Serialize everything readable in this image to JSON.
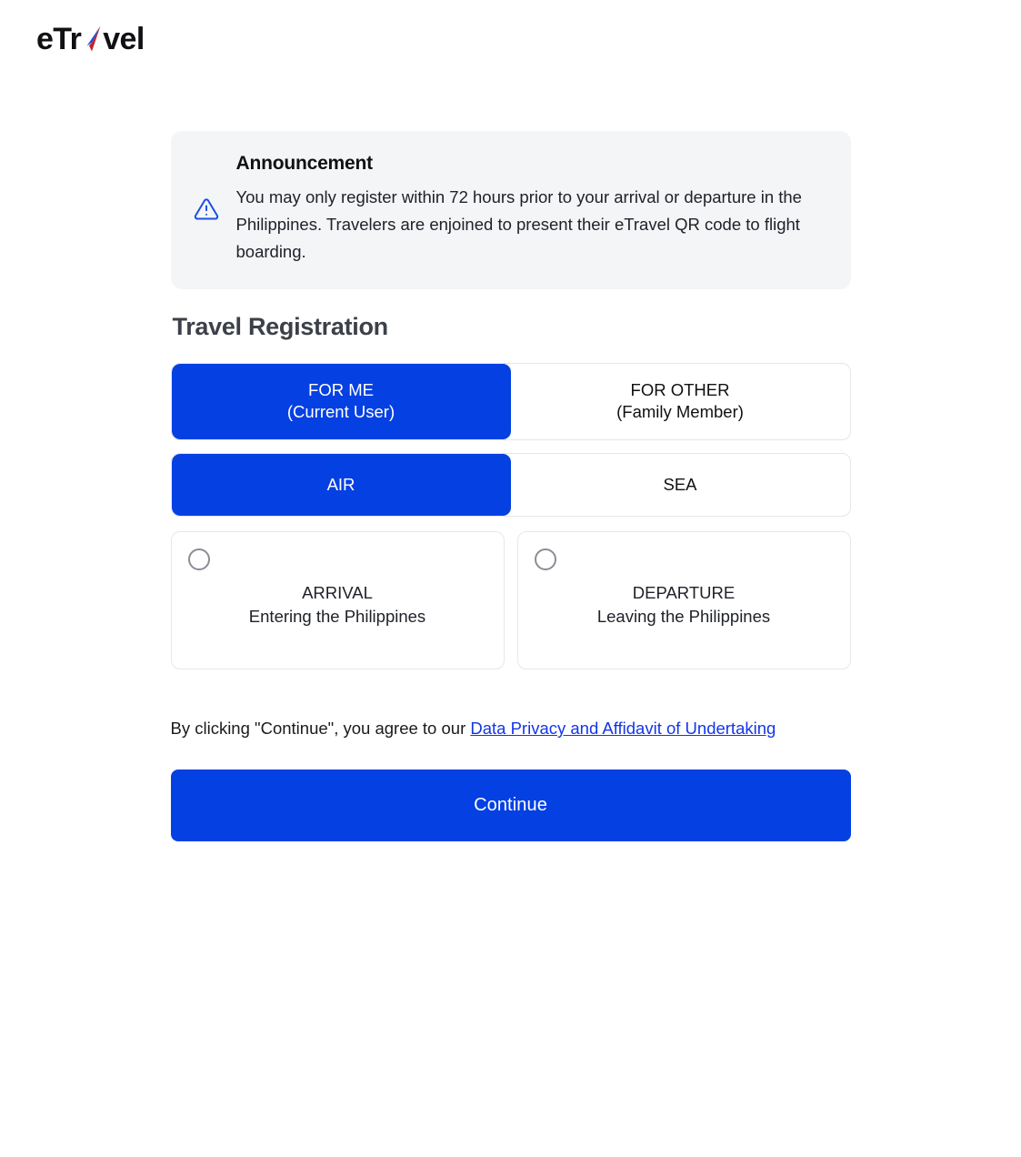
{
  "brand": {
    "name_prefix": "eTr",
    "name_suffix": "vel",
    "mark_icon": "paper-plane-icon",
    "colors": {
      "blue": "#1a4fe0",
      "red": "#c4202a",
      "text": "#111114"
    }
  },
  "announcement": {
    "icon": "warning-triangle-icon",
    "title": "Announcement",
    "text": "You may only register within 72 hours prior to your arrival or departure in the Philippines. Travelers are enjoined to present their eTravel QR code to flight boarding."
  },
  "section": {
    "title": "Travel Registration"
  },
  "registrant_toggle": {
    "options": [
      {
        "line1": "FOR ME",
        "line2": "(Current User)",
        "selected": true
      },
      {
        "line1": "FOR OTHER",
        "line2": "(Family Member)",
        "selected": false
      }
    ]
  },
  "mode_toggle": {
    "options": [
      {
        "label": "AIR",
        "selected": true
      },
      {
        "label": "SEA",
        "selected": false
      }
    ]
  },
  "direction_cards": [
    {
      "radio_icon": "radio-unselected-icon",
      "title": "ARRIVAL",
      "subtitle": "Entering the Philippines",
      "selected": false
    },
    {
      "radio_icon": "radio-unselected-icon",
      "title": "DEPARTURE",
      "subtitle": "Leaving the Philippines",
      "selected": false
    }
  ],
  "consent": {
    "prefix": "By clicking \"Continue\", you agree to our ",
    "link_label": "Data Privacy and Affidavit of Undertaking"
  },
  "actions": {
    "continue_label": "Continue"
  },
  "theme": {
    "accent_blue": "#0540e3",
    "link_blue": "#1336e8",
    "panel_gray": "#f4f5f7",
    "border_gray": "#e6e7ea"
  }
}
